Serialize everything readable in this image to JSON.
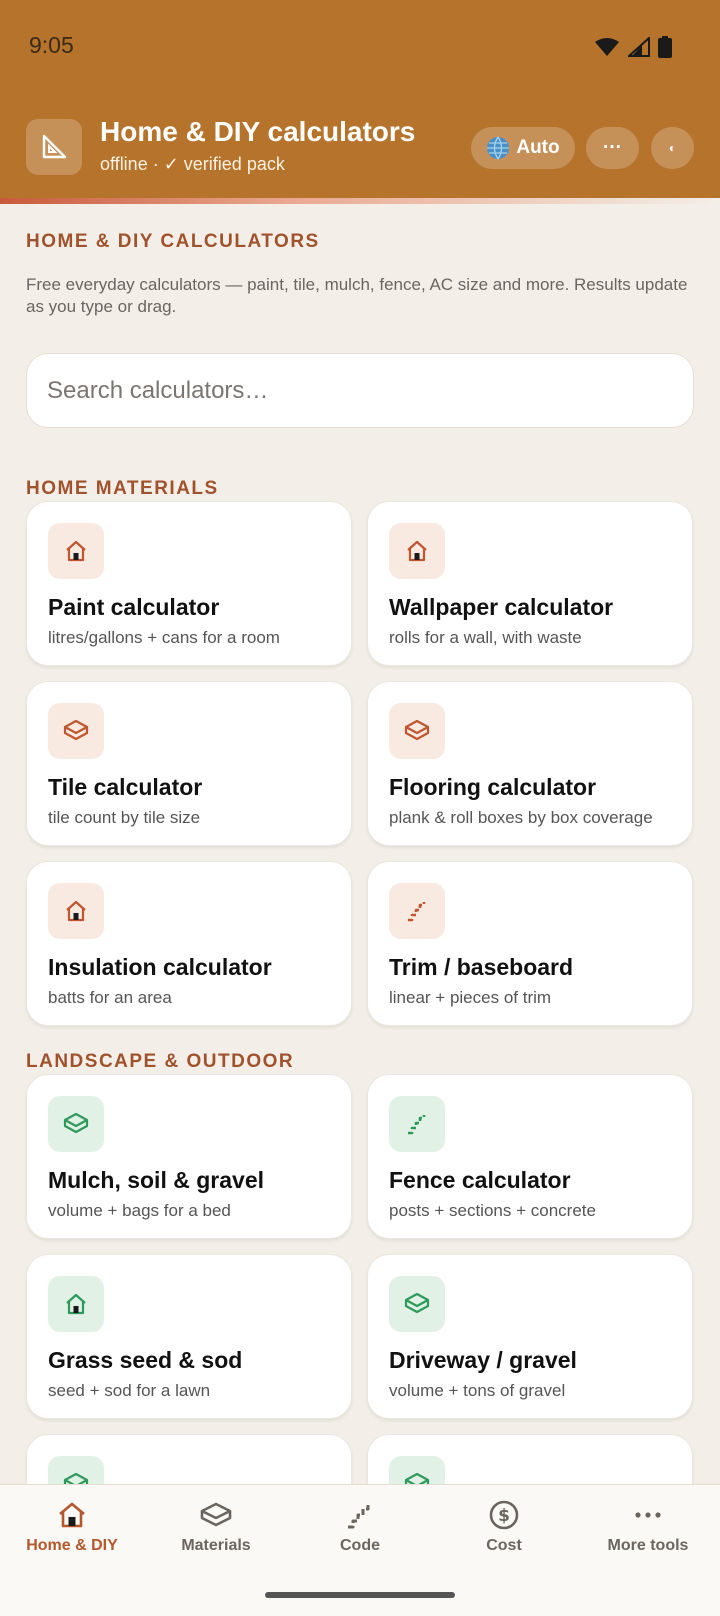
{
  "status": {
    "time": "9:05"
  },
  "header": {
    "title": "Home & DIY calculators",
    "subtitle": "offline · ✓ verified pack",
    "lang_button": "Auto",
    "more_button": "···",
    "theme_button": "◐"
  },
  "intro": {
    "heading": "HOME & DIY CALCULATORS",
    "text": "Free everyday calculators — paint, tile, mulch, fence, AC size and more. Results update as you type or drag."
  },
  "search": {
    "placeholder": "Search calculators…",
    "value": ""
  },
  "sections": {
    "home": {
      "heading": "HOME MATERIALS"
    },
    "landscape": {
      "heading": "LANDSCAPE & OUTDOOR"
    }
  },
  "cards": [
    {
      "title": "Paint calculator",
      "subtitle": "litres/gallons + cans for a room",
      "icon": "house-icon"
    },
    {
      "title": "Wallpaper calculator",
      "subtitle": "rolls for a wall, with waste",
      "icon": "house-icon"
    },
    {
      "title": "Tile calculator",
      "subtitle": "tile count by tile size",
      "icon": "layers-icon"
    },
    {
      "title": "Flooring calculator",
      "subtitle": "plank & roll boxes by box coverage",
      "icon": "layers-icon"
    },
    {
      "title": "Insulation calculator",
      "subtitle": "batts for an area",
      "icon": "house-icon"
    },
    {
      "title": "Trim / baseboard",
      "subtitle": "linear + pieces of trim",
      "icon": "stairs-icon"
    },
    {
      "title": "Mulch, soil & gravel",
      "subtitle": "volume + bags for a bed",
      "icon": "layers-icon"
    },
    {
      "title": "Fence calculator",
      "subtitle": "posts + sections + concrete",
      "icon": "stairs-icon"
    },
    {
      "title": "Grass seed & sod",
      "subtitle": "seed + sod for a lawn",
      "icon": "house-icon"
    },
    {
      "title": "Driveway / gravel",
      "subtitle": "volume + tons of gravel",
      "icon": "layers-icon"
    }
  ],
  "bottom_nav": [
    {
      "label": "Home & DIY",
      "icon": "house-icon",
      "active": true
    },
    {
      "label": "Materials",
      "icon": "layers-icon",
      "active": false
    },
    {
      "label": "Code",
      "icon": "stairs-icon",
      "active": false
    },
    {
      "label": "Cost",
      "icon": "dollar-coin-icon",
      "active": false
    },
    {
      "label": "More tools",
      "icon": "ellipsis-icon",
      "active": false
    }
  ],
  "colors": {
    "header": "#b5732b",
    "accent": "#b5562b",
    "section_heading": "#a0522d",
    "home_icon": "#c0552f",
    "landscape_icon": "#2e9a5a",
    "background": "#f3efe8"
  }
}
